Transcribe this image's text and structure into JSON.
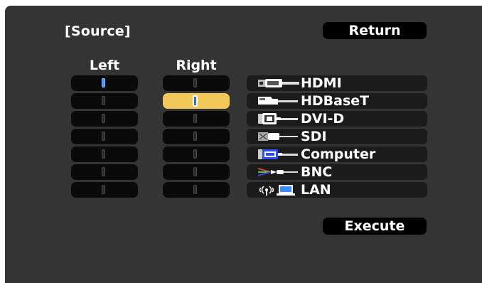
{
  "title": "[Source]",
  "buttons": {
    "return": "Return",
    "execute": "Execute"
  },
  "columns": {
    "left": "Left",
    "right": "Right"
  },
  "sources": [
    {
      "label": "HDMI",
      "icon": "hdmi-icon"
    },
    {
      "label": "HDBaseT",
      "icon": "hdbaset-icon"
    },
    {
      "label": "DVI-D",
      "icon": "dvi-d-icon"
    },
    {
      "label": "SDI",
      "icon": "sdi-icon"
    },
    {
      "label": "Computer",
      "icon": "computer-icon"
    },
    {
      "label": "BNC",
      "icon": "bnc-icon"
    },
    {
      "label": "LAN",
      "icon": "lan-icon"
    }
  ],
  "left_selected_row": 0,
  "right_selected_row": 1,
  "colors": {
    "highlight": "#f2c85a",
    "indicator": "#3a8cff",
    "background": "#343434"
  }
}
